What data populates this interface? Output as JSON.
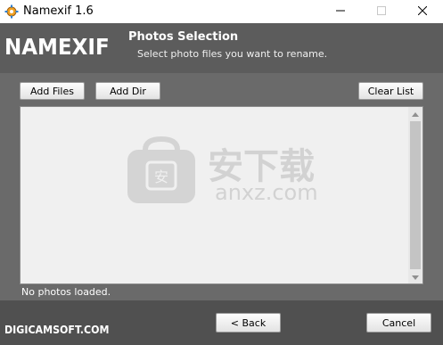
{
  "window": {
    "title": "Namexif 1.6"
  },
  "header": {
    "logo": "NAMEXIF",
    "title": "Photos Selection",
    "subtitle": "Select photo files you want to rename."
  },
  "toolbar": {
    "add_files_label": "Add Files",
    "add_dir_label": "Add Dir",
    "clear_list_label": "Clear List"
  },
  "photo_list": {
    "items": [],
    "status": "No photos loaded."
  },
  "watermark": {
    "text_cn": "安下载",
    "text_en": "anxz.com"
  },
  "footer": {
    "brand": "DIGICAMSOFT.COM",
    "back_label": "< Back",
    "cancel_label": "Cancel"
  },
  "colors": {
    "header_bg": "#5c5c5c",
    "content_bg": "#6a6a6a",
    "footer_bg": "#505050",
    "list_bg": "#f0f0f0"
  }
}
